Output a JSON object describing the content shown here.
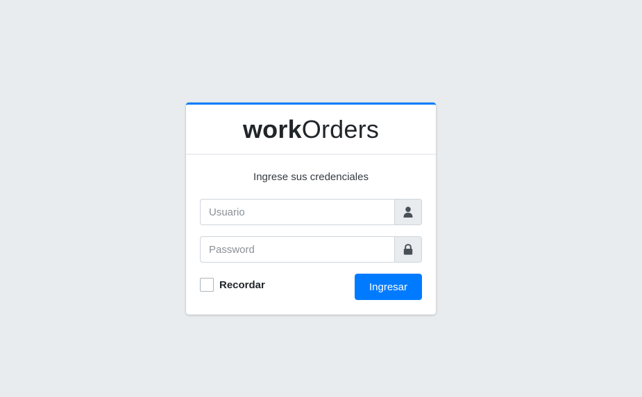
{
  "brand": {
    "bold": "work",
    "light": "Orders"
  },
  "login": {
    "message": "Ingrese sus credenciales",
    "username_placeholder": "Usuario",
    "password_placeholder": "Password",
    "remember_label": "Recordar",
    "remember_checked": false,
    "submit_label": "Ingresar"
  },
  "icons": {
    "username": "user-icon",
    "password": "lock-icon"
  },
  "colors": {
    "accent": "#007bff",
    "background": "#e9ecef"
  }
}
